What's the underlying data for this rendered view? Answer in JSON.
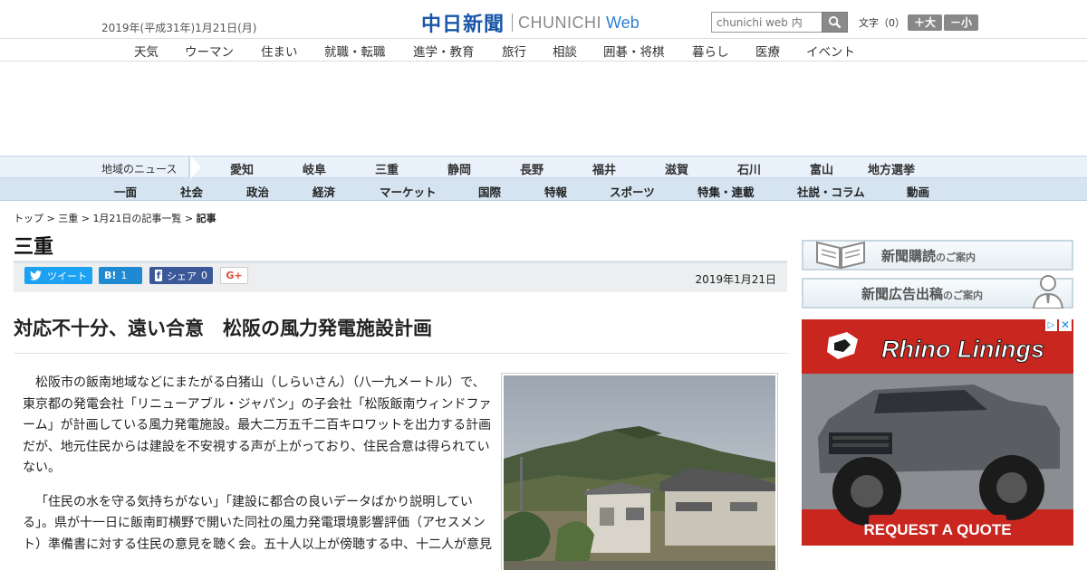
{
  "header": {
    "date": "2019年(平成31年)1月21日(月)",
    "logo_kanji": "中日新聞",
    "logo_en": "CHUNICHI",
    "logo_web": "Web",
    "search_placeholder": "chunichi web 内",
    "font_label": "文字（0）",
    "font_larger": "＋大",
    "font_smaller": "－小"
  },
  "subnav": [
    "天気",
    "ウーマン",
    "住まい",
    "就職・転職",
    "進学・教育",
    "旅行",
    "相談",
    "囲碁・将棋",
    "暮らし",
    "医療",
    "イベント"
  ],
  "regions": {
    "label": "地域のニュース",
    "items": [
      "愛知",
      "岐阜",
      "三重",
      "静岡",
      "長野",
      "福井",
      "滋賀",
      "石川",
      "富山",
      "地方選挙"
    ]
  },
  "categories": [
    "一面",
    "社会",
    "政治",
    "経済",
    "マーケット",
    "国際",
    "特報",
    "スポーツ",
    "特集・連載",
    "社説・コラム",
    "動画"
  ],
  "breadcrumb": {
    "top": "トップ",
    "region": "三重",
    "list": "1月21日の記事一覧",
    "current": "記事",
    "sep": " > "
  },
  "section_title": "三重",
  "share": {
    "tweet": "ツイート",
    "hatena_icon": "B!",
    "hatena_count": "1",
    "facebook_icon": "f",
    "facebook": "シェア",
    "facebook_count": "0",
    "gplus": "G+",
    "date": "2019年1月21日"
  },
  "article": {
    "headline": "対応不十分、遠い合意　松阪の風力発電施設計画",
    "paragraphs": [
      "松阪市の飯南地域などにまたがる白猪山（しらいさん）（八一九メートル）で、東京都の発電会社「リニューアブル・ジャパン」の子会社「松阪飯南ウィンドファーム」が計画している風力発電施設。最大二万五千二百キロワットを出力する計画だが、地元住民からは建設を不安視する声が上がっており、住民合意は得られていない。",
      "「住民の水を守る気持ちがない」「建設に都合の良いデータばかり説明している」。県が十一日に飯南町横野で開いた同社の風力発電環境影響評価（アセスメント）準備書に対する住民の意見を聴く会。五十人以上が傍聴する中、十二人が意見"
    ]
  },
  "banners": {
    "subscribe": "新聞購読",
    "subscribe_suffix": "のご案内",
    "advertise": "新聞広告出稿",
    "advertise_suffix": "のご案内"
  },
  "ad": {
    "brand": "Rhino Linings",
    "cta": "REQUEST A QUOTE"
  },
  "colors": {
    "brand_blue": "#1a56a8",
    "region_bar": "#e9f1fa",
    "category_bar": "#d6e4f2",
    "ad_red": "#c8261f"
  }
}
